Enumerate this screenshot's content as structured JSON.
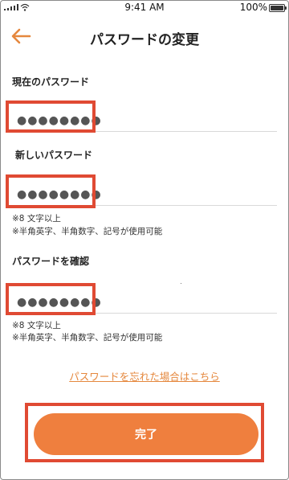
{
  "status_bar": {
    "time": "9:41 AM",
    "battery": "100%"
  },
  "header": {
    "title": "パスワードの変更",
    "back_icon": "arrow-left-icon"
  },
  "current_password": {
    "label": "現在のパスワード",
    "value": "●●●●●●●●"
  },
  "new_password": {
    "label": "新しいパスワード",
    "value": "●●●●●●●●",
    "hint_1": "※8 文字以上",
    "hint_2": "※半角英字、半角数字、記号が使用可能"
  },
  "confirm_password": {
    "label": "パスワードを確認",
    "value": "●●●●●●●●",
    "hint_1": "※8 文字以上",
    "hint_2": "※半角英字、半角数字、記号が使用可能"
  },
  "forgot_link": "パスワードを忘れた場合はこちら",
  "submit_button": "完了",
  "colors": {
    "accent": "#ef7f3e",
    "highlight": "#e04a33",
    "link": "#e5883e"
  }
}
